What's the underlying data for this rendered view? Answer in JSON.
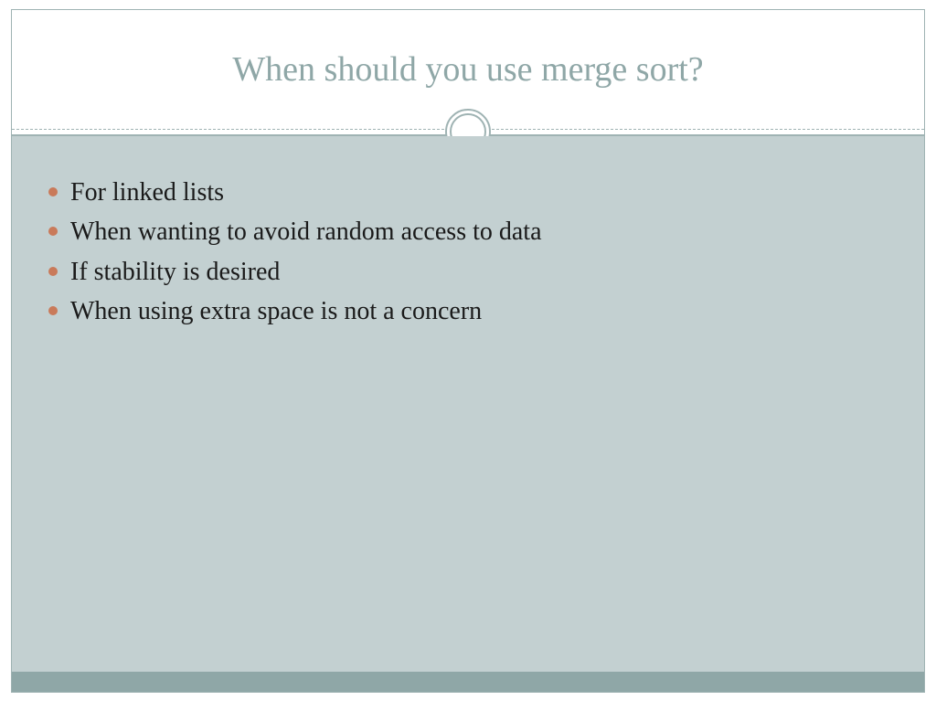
{
  "title": "When should you use merge sort?",
  "bullets": [
    "For linked lists",
    "When wanting to avoid random access to data",
    "If stability is desired",
    "When using extra space is not a concern"
  ]
}
